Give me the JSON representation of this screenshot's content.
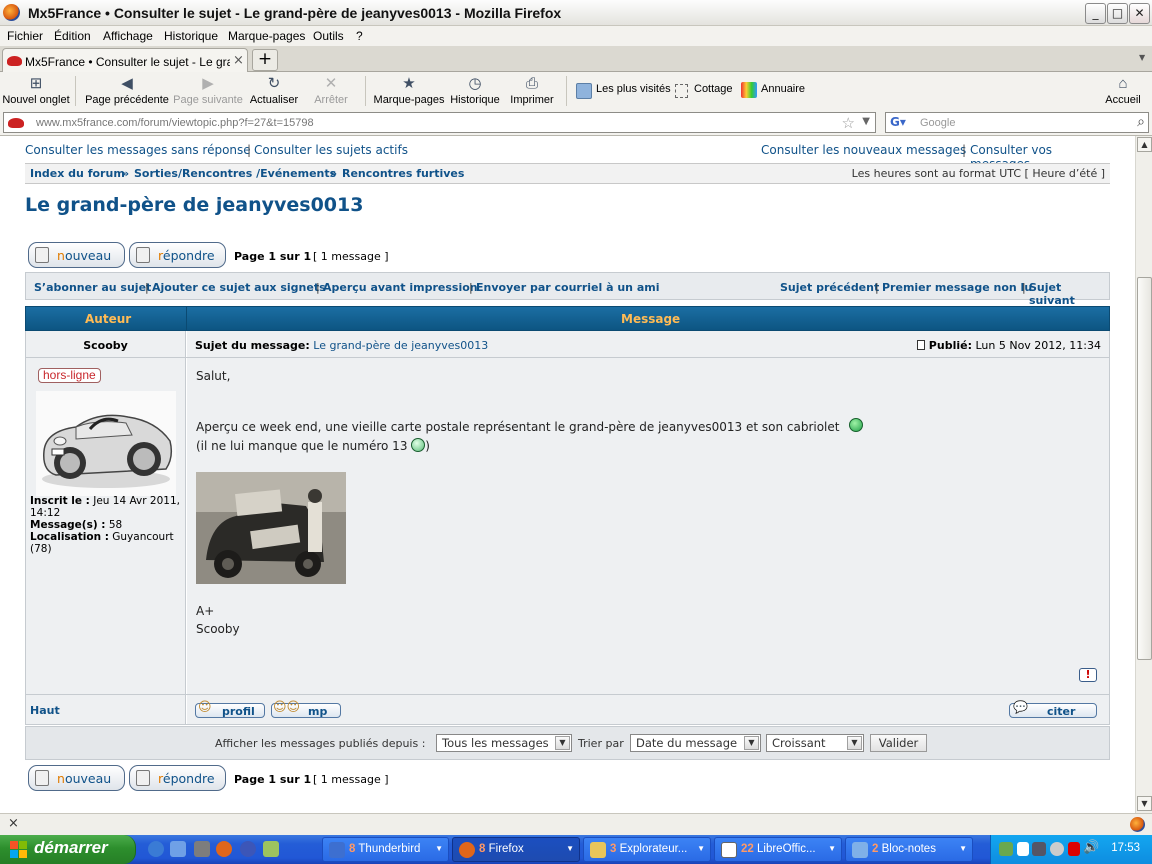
{
  "window": {
    "title": "Mx5France • Consulter le sujet - Le grand-père de jeanyves0013 - Mozilla Firefox",
    "buttons": {
      "minimize": "_",
      "maximize": "□",
      "close": "✕"
    }
  },
  "menu": [
    "Fichier",
    "Édition",
    "Affichage",
    "Historique",
    "Marque-pages",
    "Outils",
    "?"
  ],
  "tab": {
    "title": "Mx5France • Consulter le sujet - Le grand-p...",
    "close": "×",
    "new": "+"
  },
  "toolbar": {
    "new_tab": "Nouvel onglet",
    "back": "Page précédente",
    "forward": "Page suivante",
    "reload": "Actualiser",
    "stop": "Arrêter",
    "bookmarks": "Marque-pages",
    "history": "Historique",
    "print": "Imprimer",
    "home": "Accueil",
    "bookmark_items": [
      "Les plus visités",
      "Cottage",
      "Annuaire"
    ]
  },
  "urlbar": {
    "url": "www.mx5france.com/forum/viewtopic.php?f=27&t=15798",
    "search_placeholder": "Google"
  },
  "forum": {
    "nav_left_1": "Consulter les messages sans réponse",
    "nav_left_2": "Consulter les sujets actifs",
    "nav_right_1": "Consulter les nouveaux messages",
    "nav_right_2": "Consulter vos messages",
    "crumbs": [
      "Index du forum",
      "Sorties/Rencontres /Evénements",
      "Rencontres furtives"
    ],
    "timezone": "Les heures sont au format UTC [ Heure d’été ]",
    "topic_title": "Le grand-père de jeanyves0013",
    "btn_new_first": "n",
    "btn_new_rest": "ouveau",
    "btn_reply_first": "r",
    "btn_reply_rest": "épondre",
    "page_info": "Page 1 sur 1",
    "msg_count": "[ 1 message ]",
    "actions_left": [
      "S’abonner au sujet",
      "Ajouter ce sujet aux signets",
      "Aperçu avant impression",
      "Envoyer par courriel à un ami"
    ],
    "actions_right": [
      "Sujet précédent",
      "Premier message non lu",
      "Sujet suivant"
    ],
    "col_author": "Auteur",
    "col_message": "Message",
    "post": {
      "author": "Scooby",
      "subject_label": "Sujet du message:",
      "subject": "Le grand-père de jeanyves0013",
      "published_label": "Publié:",
      "published": "Lun 5 Nov 2012, 11:34",
      "status_badge": "hors-ligne",
      "joined_label": "Inscrit le :",
      "joined": "Jeu 14 Avr 2011, 14:12",
      "messages_label": "Message(s) :",
      "messages": "58",
      "location_label": "Localisation :",
      "location": "Guyancourt (78)",
      "line1": "Salut,",
      "line2": "Aperçu ce week end, une vieille carte postale représentant le grand-père de jeanyves0013 et son cabriolet",
      "line3": "(il ne lui manque que le numéro 13",
      "line3_end": ")",
      "sig1": "A+",
      "sig2": "Scooby",
      "top_link": "Haut",
      "btn_profile": "profil",
      "btn_pm": "mp",
      "btn_quote": "citer",
      "report": "!"
    },
    "sort": {
      "label1": "Afficher les messages publiés depuis :",
      "sel1": "Tous les messages",
      "label2": "Trier par",
      "sel2": "Date du message",
      "sel3": "Croissant",
      "submit": "Valider"
    }
  },
  "statusbar": {
    "close": "×"
  },
  "taskbar": {
    "start": "démarrer",
    "tasks": [
      {
        "count": "8",
        "label": "Thunderbird",
        "color": "#3d6fd0"
      },
      {
        "count": "8",
        "label": "Firefox",
        "color": "#e0661a"
      },
      {
        "count": "3",
        "label": "Explorateur...",
        "color": "#e8c55a"
      },
      {
        "count": "22",
        "label": "LibreOffic...",
        "color": "#ffffff"
      },
      {
        "count": "2",
        "label": "Bloc-notes",
        "color": "#7fb0e8"
      }
    ],
    "clock": "17:53"
  }
}
